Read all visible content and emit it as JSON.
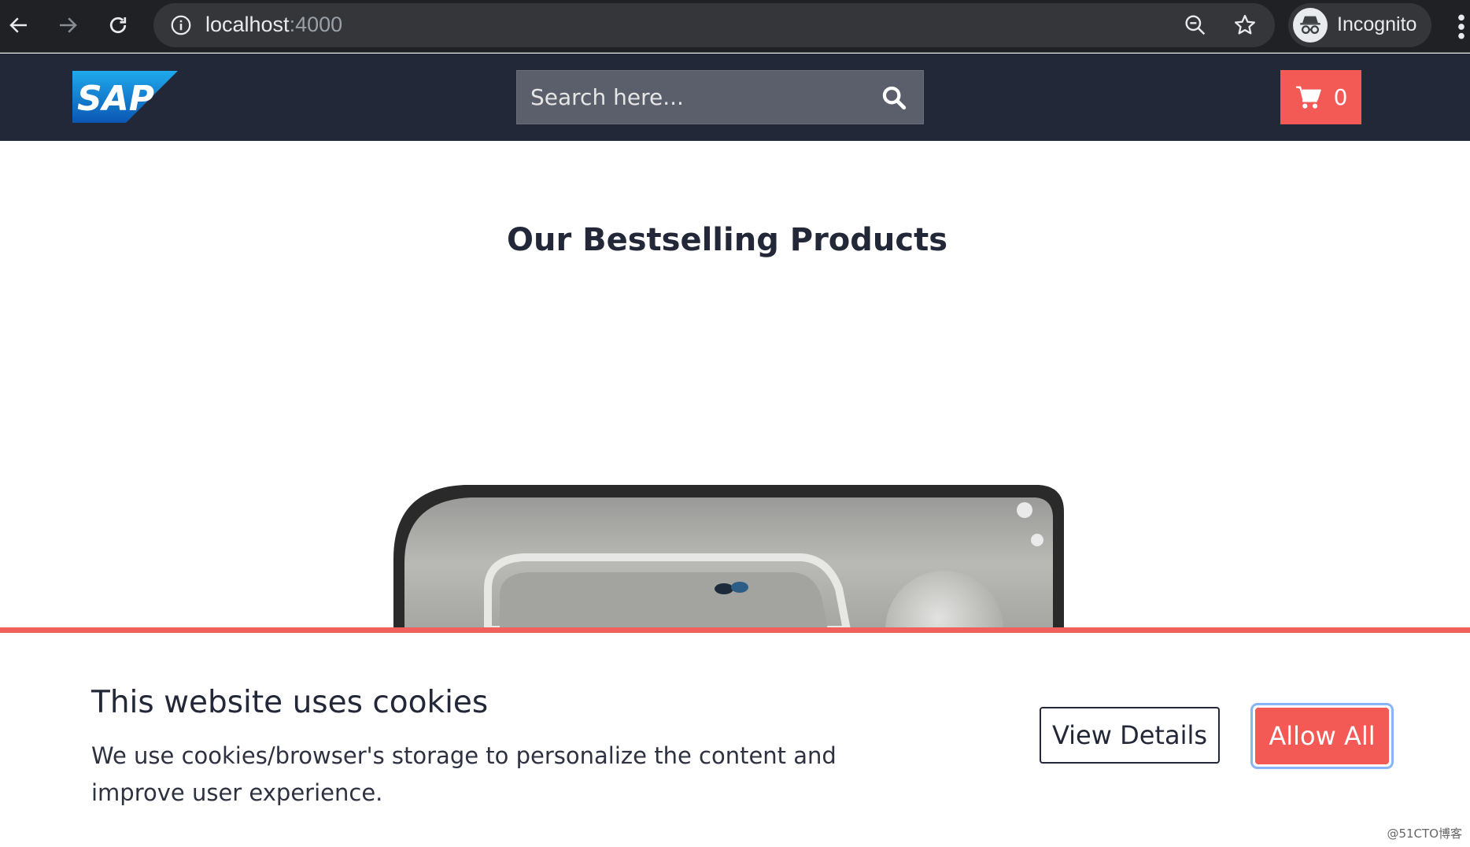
{
  "browser": {
    "url_host": "localhost",
    "url_port": ":4000",
    "profile_label": "Incognito"
  },
  "header": {
    "logo_text": "SAP",
    "search_placeholder": "Search here...",
    "cart_count": "0",
    "colors": {
      "header_bg": "#232838",
      "accent": "#f35a56"
    }
  },
  "main": {
    "heading": "Our Bestselling Products"
  },
  "cookie_banner": {
    "title": "This website uses cookies",
    "text": "We use cookies/browser's storage to personalize the content and improve user experience.",
    "view_details_label": "View Details",
    "allow_all_label": "Allow All"
  },
  "watermark": "@51CTO博客"
}
